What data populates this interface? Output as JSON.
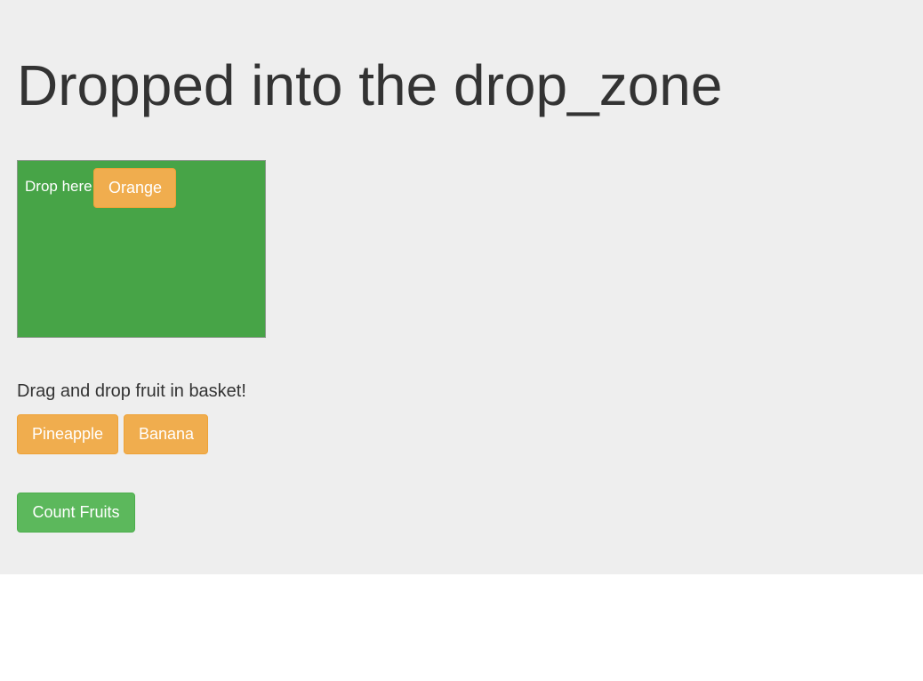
{
  "header": {
    "title": "Dropped into the drop_zone"
  },
  "drop_zone": {
    "label": "Drop here",
    "dropped_items": [
      {
        "label": "Orange"
      }
    ],
    "color": "#47a447"
  },
  "instructions": "Drag and drop fruit in basket!",
  "fruits": [
    {
      "label": "Pineapple"
    },
    {
      "label": "Banana"
    }
  ],
  "actions": {
    "count_label": "Count Fruits"
  },
  "colors": {
    "background": "#eeeeee",
    "fruit_button": "#f0ad4e",
    "success_button": "#5cb85c",
    "text": "#333333"
  }
}
